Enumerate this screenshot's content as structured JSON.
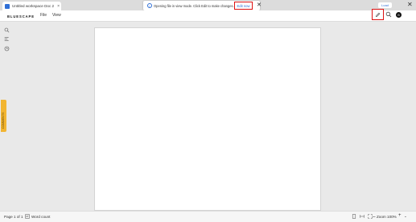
{
  "browser": {
    "tab_title": "Untitled workspace Doc 2",
    "tab_close": "×",
    "load_badge": "Load",
    "window_close": "✕"
  },
  "notification": {
    "message": "Opening file in view mode. Click Edit to make changes.",
    "edit_now": "Edit now",
    "close": "✕"
  },
  "header": {
    "logo": "BLUESCAPE",
    "menu": {
      "file": "File",
      "view": "View"
    },
    "avatar_initial": "B"
  },
  "rail": {
    "comments_label": "COMMENTS"
  },
  "footer": {
    "page_count": "Page 1 of 1",
    "word_count": "Word count",
    "zoom": "Zoom 100%",
    "zoom_in": "+",
    "zoom_menu": "⌄"
  },
  "colors": {
    "accent": "#2f6fd6",
    "highlight": "#d11111",
    "comments_tab": "#f2b531"
  },
  "icons": [
    "document-icon",
    "info-icon",
    "pencil-icon",
    "search-icon",
    "list-icon",
    "history-icon",
    "word-count-icon",
    "fit-page-icon",
    "fit-width-icon",
    "fullscreen-icon",
    "zoom-out-icon"
  ]
}
